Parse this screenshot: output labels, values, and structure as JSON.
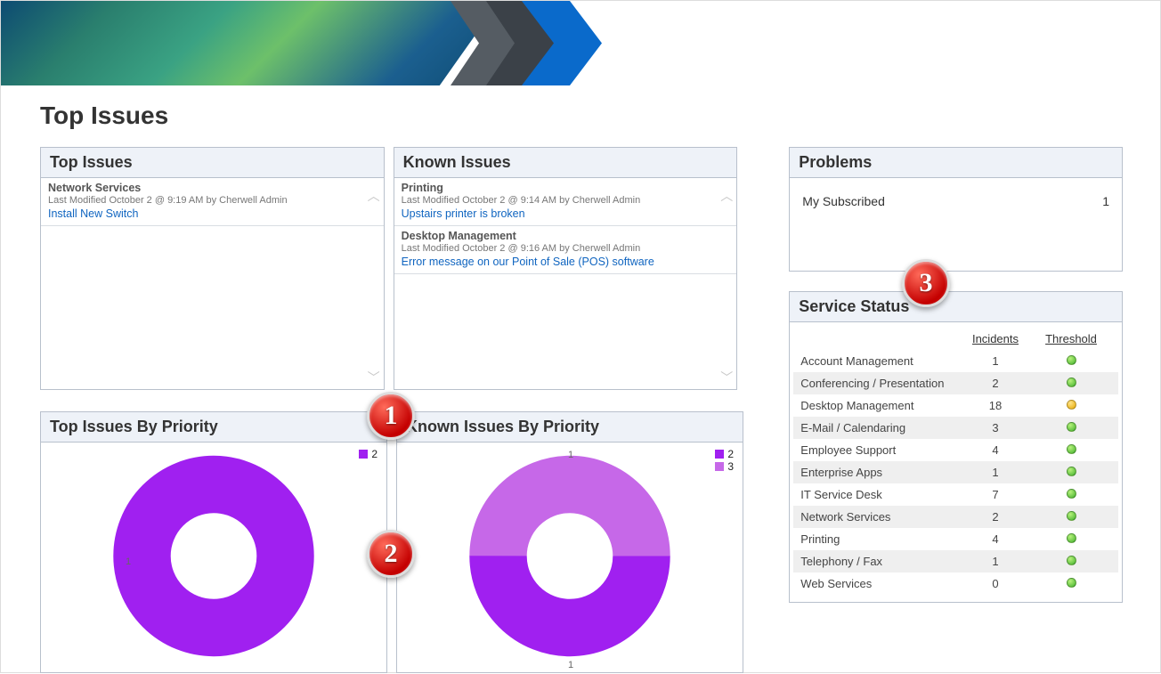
{
  "page_title": "Top Issues",
  "badges": {
    "one": "1",
    "two": "2",
    "three": "3"
  },
  "panels": {
    "top_issues": {
      "title": "Top Issues",
      "items": [
        {
          "category": "Network Services",
          "meta": "Last Modified October 2 @ 9:19 AM by Cherwell Admin",
          "link": "Install New Switch"
        }
      ]
    },
    "known_issues": {
      "title": "Known Issues",
      "items": [
        {
          "category": "Printing",
          "meta": "Last Modified October 2 @ 9:14 AM by Cherwell Admin",
          "link": "Upstairs printer is broken"
        },
        {
          "category": "Desktop Management",
          "meta": "Last Modified October 2 @ 9:16 AM by Cherwell Admin",
          "link": "Error message on our Point of Sale (POS) software"
        }
      ]
    },
    "problems": {
      "title": "Problems",
      "rows": [
        {
          "label": "My Subscribed",
          "count": "1"
        }
      ]
    },
    "service_status": {
      "title": "Service Status",
      "head_incidents": "Incidents",
      "head_threshold": "Threshold",
      "rows": [
        {
          "name": "Account Management",
          "incidents": "1",
          "threshold": "green"
        },
        {
          "name": "Conferencing / Presentation",
          "incidents": "2",
          "threshold": "green"
        },
        {
          "name": "Desktop Management",
          "incidents": "18",
          "threshold": "amber"
        },
        {
          "name": "E-Mail / Calendaring",
          "incidents": "3",
          "threshold": "green"
        },
        {
          "name": "Employee Support",
          "incidents": "4",
          "threshold": "green"
        },
        {
          "name": "Enterprise Apps",
          "incidents": "1",
          "threshold": "green"
        },
        {
          "name": "IT Service Desk",
          "incidents": "7",
          "threshold": "green"
        },
        {
          "name": "Network Services",
          "incidents": "2",
          "threshold": "green"
        },
        {
          "name": "Printing",
          "incidents": "4",
          "threshold": "green"
        },
        {
          "name": "Telephony / Fax",
          "incidents": "1",
          "threshold": "green"
        },
        {
          "name": "Web Services",
          "incidents": "0",
          "threshold": "green"
        }
      ]
    },
    "top_issues_priority": {
      "title": "Top Issues By Priority"
    },
    "known_issues_priority": {
      "title": "Known Issues By Priority"
    }
  },
  "chart_data": [
    {
      "type": "pie",
      "title": "Top Issues By Priority",
      "series": [
        {
          "name": "2",
          "values": [
            1
          ],
          "color": "#a020f0"
        }
      ],
      "categories": [
        "2"
      ],
      "labels": [
        "1"
      ]
    },
    {
      "type": "pie",
      "title": "Known Issues By Priority",
      "series": [
        {
          "name": "2",
          "values": [
            1
          ],
          "color": "#a020f0"
        },
        {
          "name": "3",
          "values": [
            1
          ],
          "color": "#c668e8"
        }
      ],
      "categories": [
        "2",
        "3"
      ],
      "labels": [
        "1",
        "1"
      ]
    }
  ],
  "colors": {
    "purple": "#a020f0",
    "lightpurple": "#c668e8"
  }
}
